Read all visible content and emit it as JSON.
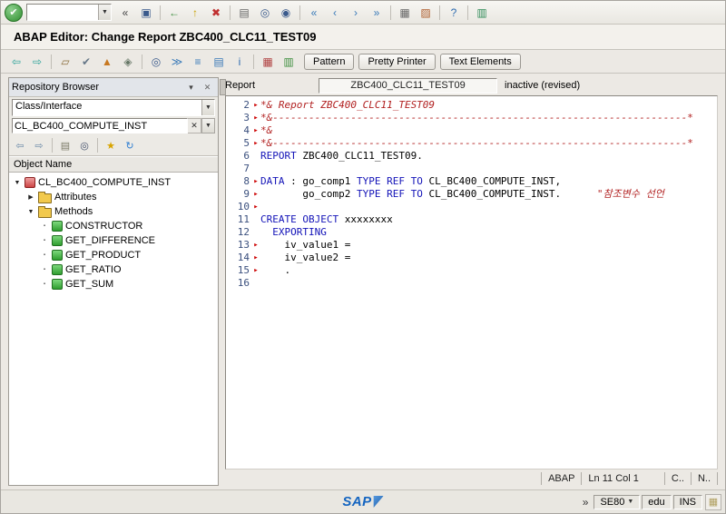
{
  "window": {
    "title": "ABAP Editor: Change Report ZBC400_CLC11_TEST09"
  },
  "glyphs": {
    "dropdown": "▼",
    "close": "✕"
  },
  "colors": {
    "keyword": "#1414b8",
    "comment": "#b22222",
    "identifier": "#000000",
    "line_number": "#3a4f7d",
    "marker": "#cc0000",
    "sap_blue": "#1565c0"
  },
  "system_toolbar": {
    "enter_icon": {
      "name": "enter-icon",
      "glyph": "✔",
      "color": "#ffffff"
    },
    "command_value": "",
    "icons": [
      {
        "name": "collapse-command-icon",
        "glyph": "«",
        "color": "#444444"
      },
      {
        "name": "save-icon",
        "glyph": "▣",
        "color": "#3a5a8c"
      },
      {
        "sep": true
      },
      {
        "name": "back-icon",
        "glyph": "←",
        "color": "#3f8f3f"
      },
      {
        "name": "exit-icon",
        "glyph": "↑",
        "color": "#c8a200"
      },
      {
        "name": "cancel-icon",
        "glyph": "✖",
        "color": "#c03030"
      },
      {
        "sep": true
      },
      {
        "name": "print-icon",
        "glyph": "▤",
        "color": "#666666"
      },
      {
        "name": "find-icon",
        "glyph": "◎",
        "color": "#3a5a8c"
      },
      {
        "name": "find-next-icon",
        "glyph": "◉",
        "color": "#3a5a8c"
      },
      {
        "sep": true
      },
      {
        "name": "first-page-icon",
        "glyph": "«",
        "color": "#3a7ab8"
      },
      {
        "name": "page-up-icon",
        "glyph": "‹",
        "color": "#3a7ab8"
      },
      {
        "name": "page-down-icon",
        "glyph": "›",
        "color": "#3a7ab8"
      },
      {
        "name": "last-page-icon",
        "glyph": "»",
        "color": "#3a7ab8"
      },
      {
        "sep": true
      },
      {
        "name": "new-session-icon",
        "glyph": "▦",
        "color": "#666666"
      },
      {
        "name": "create-shortcut-icon",
        "glyph": "▨",
        "color": "#b06030"
      },
      {
        "sep": true
      },
      {
        "name": "help-icon",
        "glyph": "?",
        "color": "#2e6bb0"
      },
      {
        "sep": true
      },
      {
        "name": "local-layout-icon",
        "glyph": "▥",
        "color": "#2e8b57"
      }
    ]
  },
  "app_toolbar": {
    "icons": [
      {
        "name": "back-icon",
        "glyph": "⇦",
        "color": "#2aa198"
      },
      {
        "name": "forward-icon",
        "glyph": "⇨",
        "color": "#2aa198"
      },
      {
        "sep": true
      },
      {
        "name": "display-change-icon",
        "glyph": "▱",
        "color": "#8a6d3b"
      },
      {
        "name": "check-icon",
        "glyph": "✔",
        "color": "#667788"
      },
      {
        "name": "activate-icon",
        "glyph": "▲",
        "color": "#c87820"
      },
      {
        "name": "test-icon",
        "glyph": "◈",
        "color": "#667766"
      },
      {
        "sep": true
      },
      {
        "name": "find-icon",
        "glyph": "◎",
        "color": "#3a5a8c"
      },
      {
        "name": "where-used-icon",
        "glyph": "≫",
        "color": "#3a7ab8"
      },
      {
        "name": "object-list-icon",
        "glyph": "≡",
        "color": "#3a7ab8"
      },
      {
        "name": "navigation-window-icon",
        "glyph": "▤",
        "color": "#3a7ab8"
      },
      {
        "name": "info-icon",
        "glyph": "i",
        "color": "#2e6bb0"
      },
      {
        "sep": true
      },
      {
        "name": "worklist-icon",
        "glyph": "▦",
        "color": "#b04040"
      },
      {
        "name": "display-list-icon",
        "glyph": "▥",
        "color": "#3f8f3f"
      }
    ],
    "buttons": [
      {
        "name": "pattern-button",
        "label": "Pattern"
      },
      {
        "name": "pretty-printer-button",
        "label": "Pretty Printer"
      },
      {
        "name": "text-elements-button",
        "label": "Text Elements"
      }
    ]
  },
  "repository_browser": {
    "header": "Repository Browser",
    "header_icons": [
      {
        "name": "browser-options-icon",
        "glyph": "▾",
        "color": "#444444"
      },
      {
        "name": "close-browser-icon",
        "glyph": "✕",
        "color": "#666666"
      }
    ],
    "category_value": "Class/Interface",
    "object_value": "CL_BC400_COMPUTE_INST",
    "toolbar_icons": [
      {
        "name": "previous-object-icon",
        "glyph": "⇦",
        "color": "#6b8aa8"
      },
      {
        "name": "next-object-icon",
        "glyph": "⇨",
        "color": "#6b8aa8"
      },
      {
        "sep": true
      },
      {
        "name": "display-object-icon",
        "glyph": "▤",
        "color": "#7a7a66"
      },
      {
        "name": "find-icon",
        "glyph": "◎",
        "color": "#44506b"
      },
      {
        "sep": true
      },
      {
        "name": "favorites-icon",
        "glyph": "★",
        "color": "#d8a400"
      },
      {
        "name": "refresh-icon",
        "glyph": "↻",
        "color": "#2e7dd1"
      }
    ],
    "column_header": "Object Name",
    "tree_glyphs": {
      "expanded": "▼",
      "collapsed": "▶",
      "leaf": "▪"
    },
    "tree": [
      {
        "label": "CL_BC400_COMPUTE_INST",
        "depth": 0,
        "icon": "class",
        "toggle": "expanded"
      },
      {
        "label": "Attributes",
        "depth": 1,
        "icon": "folder",
        "toggle": "collapsed"
      },
      {
        "label": "Methods",
        "depth": 1,
        "icon": "folder",
        "toggle": "expanded"
      },
      {
        "label": "CONSTRUCTOR",
        "depth": 2,
        "icon": "method"
      },
      {
        "label": "GET_DIFFERENCE",
        "depth": 2,
        "icon": "method"
      },
      {
        "label": "GET_PRODUCT",
        "depth": 2,
        "icon": "method"
      },
      {
        "label": "GET_RATIO",
        "depth": 2,
        "icon": "method"
      },
      {
        "label": "GET_SUM",
        "depth": 2,
        "icon": "method"
      }
    ]
  },
  "editor": {
    "report_label": "Report",
    "report_value": "ZBC400_CLC11_TEST09",
    "status_text": "inactive (revised)",
    "marker_glyph": "▸",
    "lines": [
      {
        "num": "2",
        "marker": true,
        "segs": [
          {
            "c": "cm",
            "t": "*& Report ZBC400_CLC11_TEST09"
          }
        ]
      },
      {
        "num": "3",
        "marker": true,
        "segs": [
          {
            "c": "cm",
            "t": "*&---------------------------------------------------------------------*"
          }
        ]
      },
      {
        "num": "4",
        "marker": true,
        "segs": [
          {
            "c": "cm",
            "t": "*&"
          }
        ]
      },
      {
        "num": "5",
        "marker": true,
        "segs": [
          {
            "c": "cm",
            "t": "*&---------------------------------------------------------------------*"
          }
        ]
      },
      {
        "num": "6",
        "marker": false,
        "segs": [
          {
            "c": "kw",
            "t": "REPORT"
          },
          {
            "c": "id",
            "t": " ZBC400_CLC11_TEST09."
          }
        ]
      },
      {
        "num": "7",
        "marker": false,
        "segs": []
      },
      {
        "num": "8",
        "marker": true,
        "segs": [
          {
            "c": "kw",
            "t": "DATA"
          },
          {
            "c": "id",
            "t": " : go_comp1 "
          },
          {
            "c": "kw",
            "t": "TYPE REF TO"
          },
          {
            "c": "id",
            "t": " CL_BC400_COMPUTE_INST,"
          }
        ]
      },
      {
        "num": "9",
        "marker": true,
        "segs": [
          {
            "c": "id",
            "t": "       go_comp2 "
          },
          {
            "c": "kw",
            "t": "TYPE REF TO"
          },
          {
            "c": "id",
            "t": " CL_BC400_COMPUTE_INST."
          },
          {
            "c": "cm",
            "t": "      \"참조변수 선언"
          }
        ]
      },
      {
        "num": "10",
        "marker": true,
        "segs": []
      },
      {
        "num": "11",
        "marker": false,
        "segs": [
          {
            "c": "kw",
            "t": "CREATE OBJECT"
          },
          {
            "c": "id",
            "t": " xxxxxxxx"
          }
        ]
      },
      {
        "num": "12",
        "marker": false,
        "segs": [
          {
            "c": "kw",
            "t": "  EXPORTING"
          }
        ]
      },
      {
        "num": "13",
        "marker": true,
        "segs": [
          {
            "c": "id",
            "t": "    iv_value1 ="
          }
        ]
      },
      {
        "num": "14",
        "marker": true,
        "segs": [
          {
            "c": "id",
            "t": "    iv_value2 ="
          }
        ]
      },
      {
        "num": "15",
        "marker": true,
        "segs": [
          {
            "c": "id",
            "t": "    ."
          }
        ]
      },
      {
        "num": "16",
        "marker": false,
        "segs": []
      }
    ],
    "statusbar_segments": [
      "ABAP",
      "Ln 11 Col 1",
      "C..",
      "N.."
    ]
  },
  "status_bar": {
    "logo_text": "SAP",
    "expand_label": "»",
    "segments": [
      {
        "name": "system-field",
        "label": "SE80",
        "dropdown": true
      },
      {
        "name": "client-field",
        "label": "edu"
      },
      {
        "name": "insert-mode-field",
        "label": "INS"
      }
    ],
    "icon": {
      "name": "response-monitor-icon",
      "glyph": "▦",
      "color": "#b0a060"
    }
  }
}
